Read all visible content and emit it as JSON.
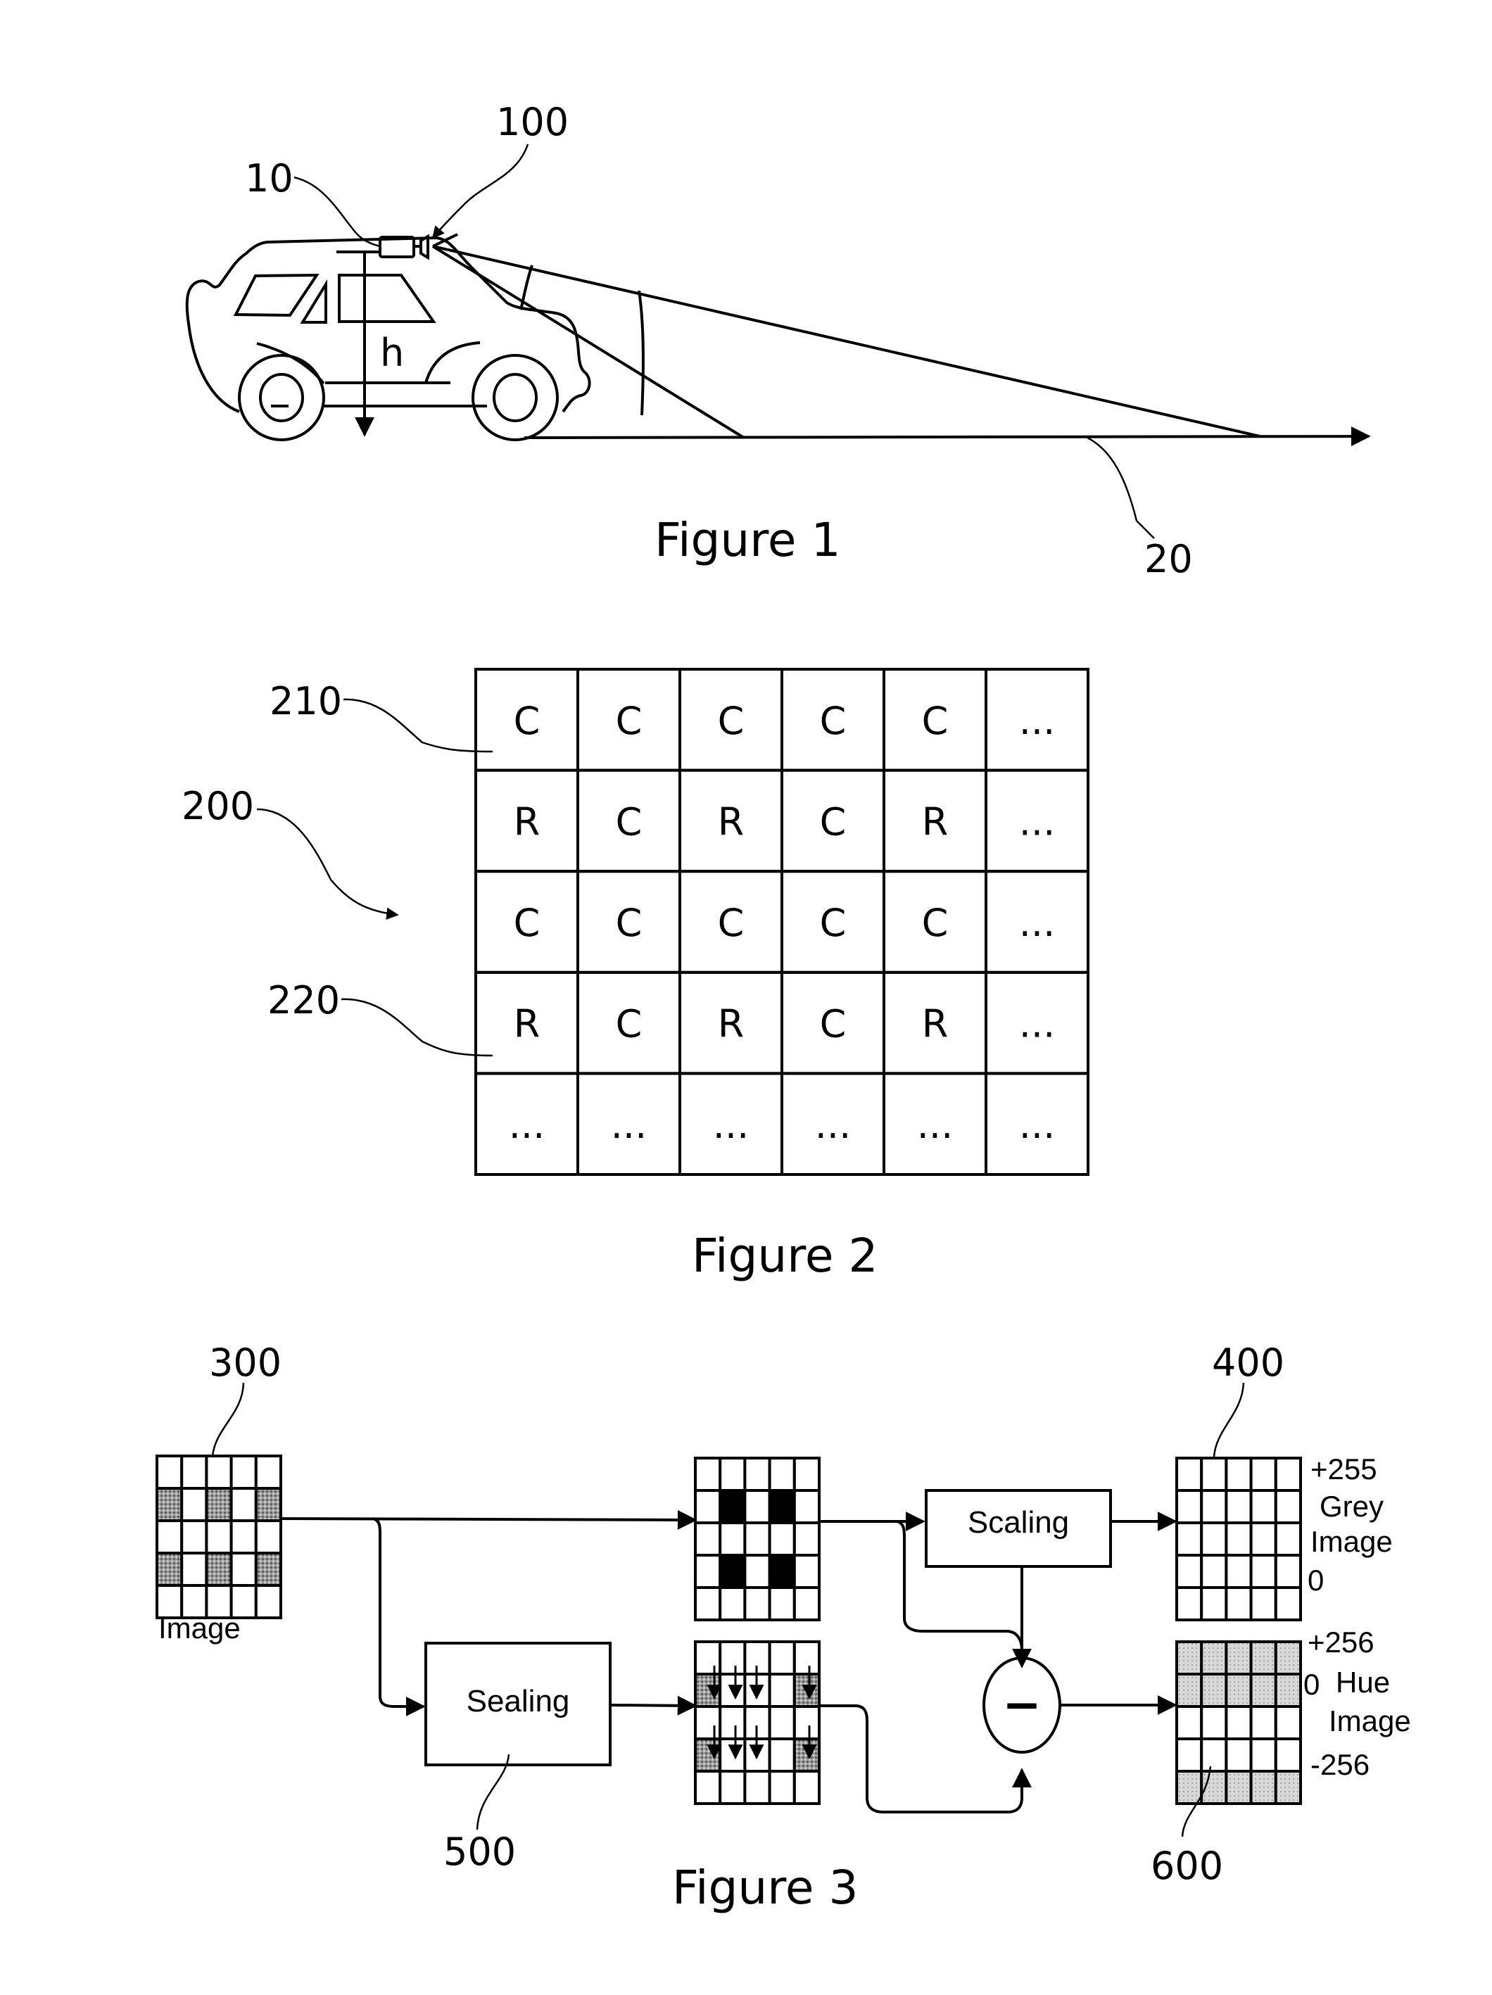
{
  "figure1": {
    "caption": "Figure 1",
    "labels": {
      "system": "100",
      "camera": "10",
      "height": "h",
      "road": "20"
    }
  },
  "figure2": {
    "caption": "Figure 2",
    "labels": {
      "array": "200",
      "clear_pixel": "210",
      "red_pixel": "220"
    },
    "grid": [
      [
        "C",
        "C",
        "C",
        "C",
        "C",
        "..."
      ],
      [
        "R",
        "C",
        "R",
        "C",
        "R",
        "..."
      ],
      [
        "C",
        "C",
        "C",
        "C",
        "C",
        "..."
      ],
      [
        "R",
        "C",
        "R",
        "C",
        "R",
        "..."
      ],
      [
        "...",
        "...",
        "...",
        "...",
        "...",
        "..."
      ]
    ]
  },
  "figure3": {
    "caption": "Figure 3",
    "labels": {
      "input_image": "300",
      "grey_image": "400",
      "scaling_unit": "500",
      "hue_image": "600"
    },
    "input_caption": "Image",
    "scaling_box": "Scaling",
    "sealing_box": "Sealing",
    "subtract_symbol": "−",
    "grey_output": {
      "top": "+255",
      "name_line1": "Grey",
      "name_line2": "Image",
      "bottom": "0"
    },
    "hue_output": {
      "top": "+256",
      "mid": "0",
      "name_line1": "Hue",
      "name_line2": "Image",
      "bottom": "-256"
    }
  }
}
